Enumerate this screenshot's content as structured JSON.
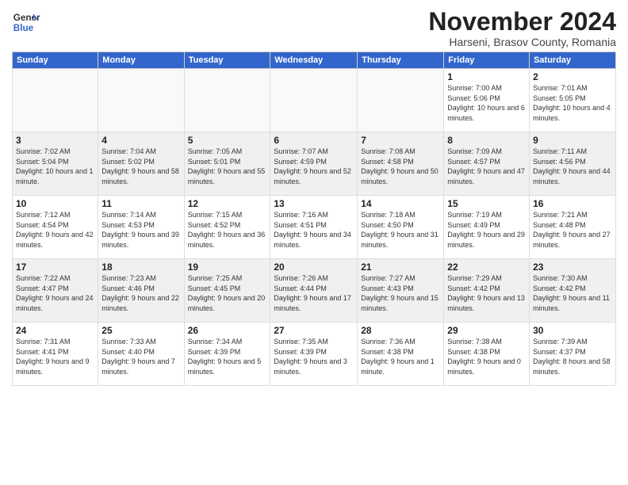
{
  "header": {
    "logo_line1": "General",
    "logo_line2": "Blue",
    "month": "November 2024",
    "location": "Harseni, Brasov County, Romania"
  },
  "weekdays": [
    "Sunday",
    "Monday",
    "Tuesday",
    "Wednesday",
    "Thursday",
    "Friday",
    "Saturday"
  ],
  "weeks": [
    [
      {
        "day": "",
        "info": ""
      },
      {
        "day": "",
        "info": ""
      },
      {
        "day": "",
        "info": ""
      },
      {
        "day": "",
        "info": ""
      },
      {
        "day": "",
        "info": ""
      },
      {
        "day": "1",
        "info": "Sunrise: 7:00 AM\nSunset: 5:06 PM\nDaylight: 10 hours\nand 6 minutes."
      },
      {
        "day": "2",
        "info": "Sunrise: 7:01 AM\nSunset: 5:05 PM\nDaylight: 10 hours\nand 4 minutes."
      }
    ],
    [
      {
        "day": "3",
        "info": "Sunrise: 7:02 AM\nSunset: 5:04 PM\nDaylight: 10 hours\nand 1 minute."
      },
      {
        "day": "4",
        "info": "Sunrise: 7:04 AM\nSunset: 5:02 PM\nDaylight: 9 hours\nand 58 minutes."
      },
      {
        "day": "5",
        "info": "Sunrise: 7:05 AM\nSunset: 5:01 PM\nDaylight: 9 hours\nand 55 minutes."
      },
      {
        "day": "6",
        "info": "Sunrise: 7:07 AM\nSunset: 4:59 PM\nDaylight: 9 hours\nand 52 minutes."
      },
      {
        "day": "7",
        "info": "Sunrise: 7:08 AM\nSunset: 4:58 PM\nDaylight: 9 hours\nand 50 minutes."
      },
      {
        "day": "8",
        "info": "Sunrise: 7:09 AM\nSunset: 4:57 PM\nDaylight: 9 hours\nand 47 minutes."
      },
      {
        "day": "9",
        "info": "Sunrise: 7:11 AM\nSunset: 4:56 PM\nDaylight: 9 hours\nand 44 minutes."
      }
    ],
    [
      {
        "day": "10",
        "info": "Sunrise: 7:12 AM\nSunset: 4:54 PM\nDaylight: 9 hours\nand 42 minutes."
      },
      {
        "day": "11",
        "info": "Sunrise: 7:14 AM\nSunset: 4:53 PM\nDaylight: 9 hours\nand 39 minutes."
      },
      {
        "day": "12",
        "info": "Sunrise: 7:15 AM\nSunset: 4:52 PM\nDaylight: 9 hours\nand 36 minutes."
      },
      {
        "day": "13",
        "info": "Sunrise: 7:16 AM\nSunset: 4:51 PM\nDaylight: 9 hours\nand 34 minutes."
      },
      {
        "day": "14",
        "info": "Sunrise: 7:18 AM\nSunset: 4:50 PM\nDaylight: 9 hours\nand 31 minutes."
      },
      {
        "day": "15",
        "info": "Sunrise: 7:19 AM\nSunset: 4:49 PM\nDaylight: 9 hours\nand 29 minutes."
      },
      {
        "day": "16",
        "info": "Sunrise: 7:21 AM\nSunset: 4:48 PM\nDaylight: 9 hours\nand 27 minutes."
      }
    ],
    [
      {
        "day": "17",
        "info": "Sunrise: 7:22 AM\nSunset: 4:47 PM\nDaylight: 9 hours\nand 24 minutes."
      },
      {
        "day": "18",
        "info": "Sunrise: 7:23 AM\nSunset: 4:46 PM\nDaylight: 9 hours\nand 22 minutes."
      },
      {
        "day": "19",
        "info": "Sunrise: 7:25 AM\nSunset: 4:45 PM\nDaylight: 9 hours\nand 20 minutes."
      },
      {
        "day": "20",
        "info": "Sunrise: 7:26 AM\nSunset: 4:44 PM\nDaylight: 9 hours\nand 17 minutes."
      },
      {
        "day": "21",
        "info": "Sunrise: 7:27 AM\nSunset: 4:43 PM\nDaylight: 9 hours\nand 15 minutes."
      },
      {
        "day": "22",
        "info": "Sunrise: 7:29 AM\nSunset: 4:42 PM\nDaylight: 9 hours\nand 13 minutes."
      },
      {
        "day": "23",
        "info": "Sunrise: 7:30 AM\nSunset: 4:42 PM\nDaylight: 9 hours\nand 11 minutes."
      }
    ],
    [
      {
        "day": "24",
        "info": "Sunrise: 7:31 AM\nSunset: 4:41 PM\nDaylight: 9 hours\nand 9 minutes."
      },
      {
        "day": "25",
        "info": "Sunrise: 7:33 AM\nSunset: 4:40 PM\nDaylight: 9 hours\nand 7 minutes."
      },
      {
        "day": "26",
        "info": "Sunrise: 7:34 AM\nSunset: 4:39 PM\nDaylight: 9 hours\nand 5 minutes."
      },
      {
        "day": "27",
        "info": "Sunrise: 7:35 AM\nSunset: 4:39 PM\nDaylight: 9 hours\nand 3 minutes."
      },
      {
        "day": "28",
        "info": "Sunrise: 7:36 AM\nSunset: 4:38 PM\nDaylight: 9 hours\nand 1 minute."
      },
      {
        "day": "29",
        "info": "Sunrise: 7:38 AM\nSunset: 4:38 PM\nDaylight: 9 hours\nand 0 minutes."
      },
      {
        "day": "30",
        "info": "Sunrise: 7:39 AM\nSunset: 4:37 PM\nDaylight: 8 hours\nand 58 minutes."
      }
    ]
  ]
}
